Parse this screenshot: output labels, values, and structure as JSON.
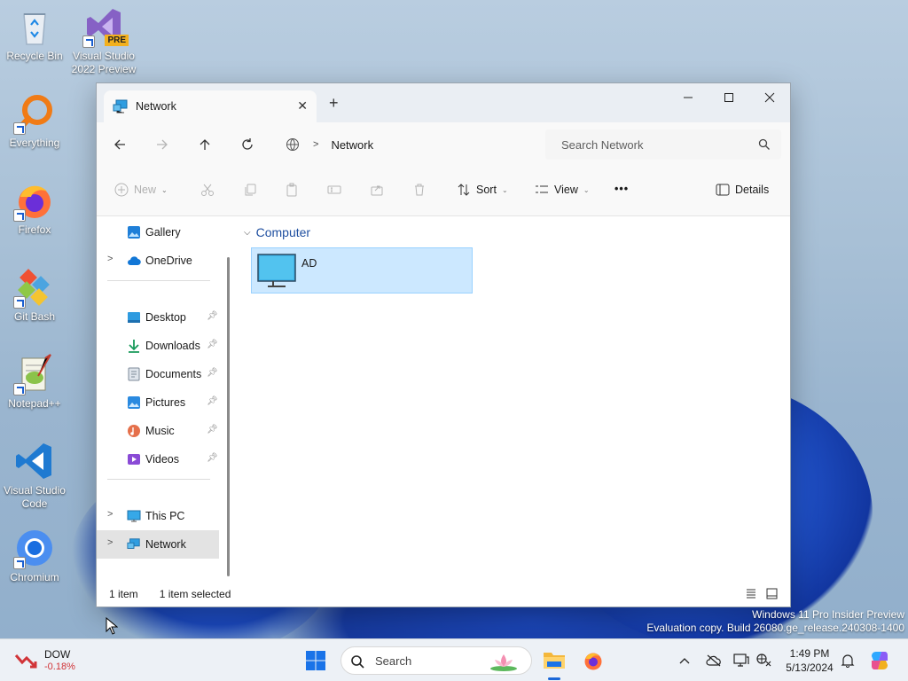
{
  "desktop": {
    "icons": [
      {
        "label": "Recycle Bin",
        "icon": "recycle-bin-icon"
      },
      {
        "label": "Visual Studio 2022 Preview",
        "icon": "visual-studio-icon",
        "badge": "PRE"
      },
      {
        "label": "Everything",
        "icon": "everything-search-icon"
      },
      {
        "label": "Firefox",
        "icon": "firefox-icon"
      },
      {
        "label": "Git Bash",
        "icon": "git-bash-icon"
      },
      {
        "label": "Notepad++",
        "icon": "notepad-plus-plus-icon"
      },
      {
        "label": "Visual Studio Code",
        "icon": "vscode-icon"
      },
      {
        "label": "Chromium",
        "icon": "chromium-icon"
      }
    ],
    "watermark": {
      "line1": "Windows 11 Pro Insider Preview",
      "line2": "Evaluation copy. Build 26080.ge_release.240308-1400"
    }
  },
  "explorer": {
    "tab": {
      "title": "Network",
      "icon": "network-icon"
    },
    "address": {
      "location": "Network"
    },
    "search": {
      "placeholder": "Search Network"
    },
    "commands": {
      "new": "New",
      "sort": "Sort",
      "view": "View",
      "more": "•••",
      "details": "Details"
    },
    "nav": {
      "gallery": "Gallery",
      "onedrive": "OneDrive",
      "desktop": "Desktop",
      "downloads": "Downloads",
      "documents": "Documents",
      "pictures": "Pictures",
      "music": "Music",
      "videos": "Videos",
      "thispc": "This PC",
      "network": "Network"
    },
    "content": {
      "group": "Computer",
      "items": [
        {
          "name": "AD",
          "selected": true
        }
      ]
    },
    "status": {
      "count": "1 item",
      "selection": "1 item selected"
    }
  },
  "taskbar": {
    "widget": {
      "ticker": "DOW",
      "change": "-0.18%"
    },
    "search": "Search",
    "clock": {
      "time": "1:49 PM",
      "date": "5/13/2024"
    },
    "colors": {
      "accent": "#1a67d8",
      "negative": "#d13438"
    }
  }
}
